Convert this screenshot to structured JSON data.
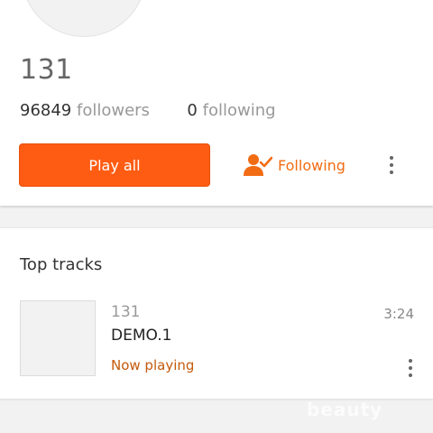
{
  "profile": {
    "username": "131",
    "followers_count": "96849",
    "followers_label": "followers",
    "following_count": "0",
    "following_label": "following",
    "play_all_label": "Play all",
    "following_button_label": "Following",
    "accent_color": "#ff5c13"
  },
  "top_tracks": {
    "title": "Top tracks",
    "tracks": [
      {
        "artist": "131",
        "title": "DEMO.1",
        "status": "Now playing",
        "duration": "3:24"
      }
    ]
  },
  "watermark": "beauty"
}
